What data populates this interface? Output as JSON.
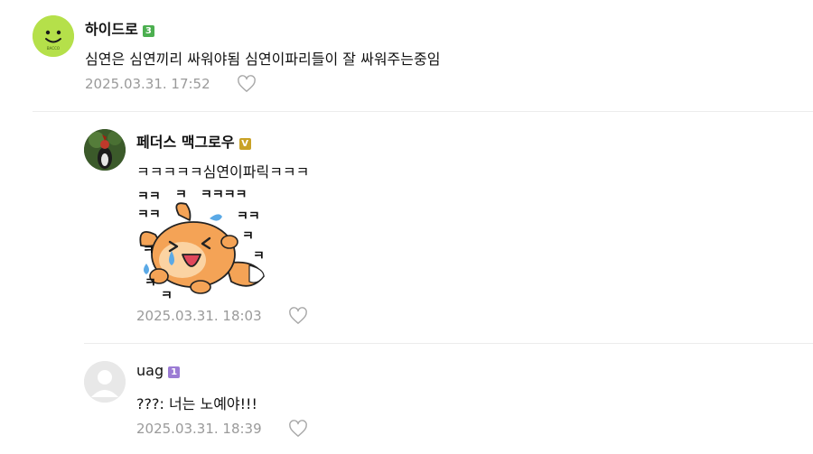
{
  "comments": [
    {
      "author": "하이드로",
      "badge": "3",
      "badge_color": "#4caf50",
      "text": "심연은 심연끼리 싸워야됨 심연이파리들이 잘 싸워주는중임",
      "timestamp": "2025.03.31. 17:52",
      "avatar_logo_text": "BACCO"
    },
    {
      "author": "페더스 맥그로우",
      "badge": "V",
      "badge_color": "#c9a227",
      "text": "ㅋㅋㅋㅋㅋ심연이파릭ㅋㅋㅋ",
      "timestamp": "2025.03.31. 18:03",
      "sticker_text": [
        "ㅋㅋ",
        "ㅋ",
        "ㅋㅋㅋㅋ",
        "ㅋㅋ",
        "ㅋㅋ",
        "ㅋ",
        "ㅋ",
        "ㅋ",
        "ㅋ",
        "ㅋ"
      ]
    },
    {
      "author": "uag",
      "badge": "1",
      "badge_color": "#9b7bd4",
      "text": "???: 너는 노예야!!!",
      "timestamp": "2025.03.31. 18:39"
    }
  ]
}
